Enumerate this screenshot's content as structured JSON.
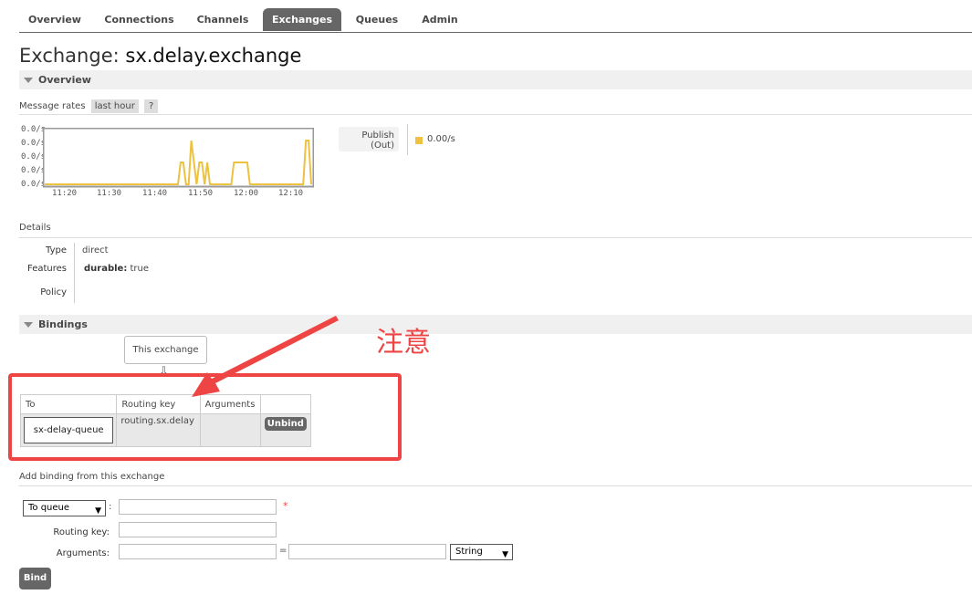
{
  "nav": {
    "tabs": [
      {
        "label": "Overview"
      },
      {
        "label": "Connections"
      },
      {
        "label": "Channels"
      },
      {
        "label": "Exchanges"
      },
      {
        "label": "Queues"
      },
      {
        "label": "Admin"
      }
    ],
    "active": "Exchanges"
  },
  "page": {
    "title_prefix": "Exchange:",
    "exchange_name": "sx.delay.exchange"
  },
  "overview": {
    "section_label": "Overview",
    "message_rates_label": "Message rates",
    "range_tag": "last hour",
    "help_tag": "?",
    "legend_label_1": "Publish",
    "legend_label_2": "(Out)",
    "legend_value": "0.00/s",
    "series_color": "#edc240"
  },
  "chart_data": {
    "type": "line",
    "x_tick_labels": [
      "11:20",
      "11:30",
      "11:40",
      "11:50",
      "12:00",
      "12:10"
    ],
    "y_tick_labels": [
      "0.0/s",
      "0.0/s",
      "0.0/s",
      "0.0/s",
      "0.0/s"
    ],
    "series": [
      {
        "values": [
          0,
          0,
          0,
          0,
          0,
          0,
          0,
          0,
          0,
          0,
          0,
          0,
          0,
          0,
          0,
          0,
          0,
          0,
          0,
          0,
          0,
          0,
          0,
          0,
          0,
          0,
          0,
          0,
          0,
          0,
          0,
          0,
          0,
          0,
          0,
          0,
          0,
          0,
          0,
          0,
          0,
          0,
          0,
          0,
          0,
          0,
          0,
          0,
          0,
          0,
          0,
          0.5,
          0.5,
          0,
          0,
          1,
          0.5,
          0,
          0.5,
          0.5,
          0,
          0.5,
          0,
          0,
          0,
          0,
          0,
          0,
          0,
          0,
          0,
          0.5,
          0.5,
          0.5,
          0.5,
          0.5,
          0.5,
          0,
          0,
          0,
          0,
          0,
          0,
          0,
          0,
          0,
          0,
          0,
          0,
          0,
          0,
          0,
          0,
          0,
          0,
          0,
          0,
          0,
          1,
          1,
          0
        ],
        "color": "#edc240"
      }
    ],
    "grid": false,
    "legend": "right"
  },
  "details": {
    "header": "Details",
    "type_label": "Type",
    "type_value": "direct",
    "features_label": "Features",
    "features_key": "durable:",
    "features_value": "true",
    "policy_label": "Policy"
  },
  "bindings": {
    "section_label": "Bindings",
    "this_exchange_label": "This exchange",
    "arrow_glyph": "⇩",
    "columns": [
      "To",
      "Routing key",
      "Arguments",
      ""
    ],
    "rows": [
      {
        "to": "sx-delay-queue",
        "routing_key": "routing.sx.delay",
        "arguments": "",
        "action": "Unbind"
      }
    ],
    "annotation_text": "注意"
  },
  "add_binding": {
    "header": "Add binding from this exchange",
    "destination_select": "To queue",
    "colon": ":",
    "required_mark": "*",
    "routing_key_label": "Routing key:",
    "arguments_label": "Arguments:",
    "equals": "=",
    "type_select": "String",
    "bind_button": "Bind"
  }
}
